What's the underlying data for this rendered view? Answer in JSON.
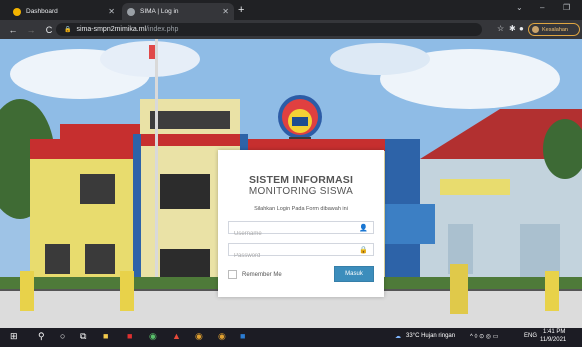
{
  "browser": {
    "tabs": [
      {
        "label": "Dashboard",
        "active": false,
        "favicon_color": "#f4b400"
      },
      {
        "label": "SIMA | Log in",
        "active": true,
        "favicon_color": "#bdc1c6"
      }
    ],
    "new_tab": "+",
    "address": {
      "host": "sima-smpn2mimika.ml",
      "path": "/index.php"
    },
    "profile_label": "Kesalahan"
  },
  "login": {
    "title_line1": "SISTEM INFORMASI",
    "title_line2": "MONITORING SISWA",
    "subtitle": "Silahkan Login Pada Form dibawah ini",
    "username_placeholder": "Username",
    "password_placeholder": "Password",
    "remember_label": "Remember Me",
    "submit_label": "Masuk"
  },
  "taskbar": {
    "weather": "33°C  Hujan ringan",
    "language": "ENG",
    "time": "1:41 PM",
    "date": "11/9/2021"
  },
  "colors": {
    "primary_button": "#3c8dbc",
    "building_blue": "#2d63a8",
    "building_red": "#c62f2f",
    "building_yellow": "#e8dc6e"
  }
}
